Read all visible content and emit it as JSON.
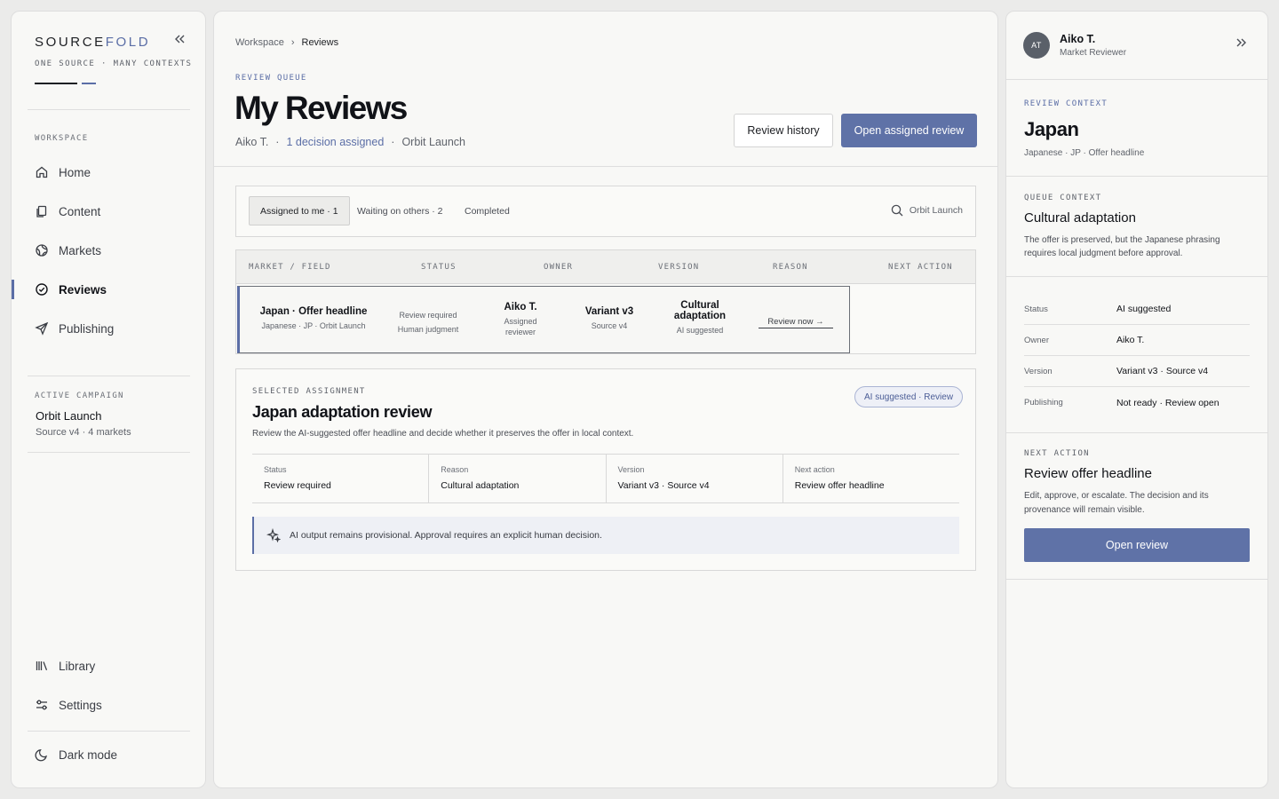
{
  "brand": {
    "name_part1": "SOURCE",
    "name_part2": "FOLD",
    "tagline": "ONE SOURCE · MANY CONTEXTS",
    "accent_color": "#5b6ea6"
  },
  "sidebar": {
    "section_label": "WORKSPACE",
    "items": [
      {
        "label": "Home",
        "icon": "home-icon"
      },
      {
        "label": "Content",
        "icon": "document-icon"
      },
      {
        "label": "Markets",
        "icon": "globe-icon"
      },
      {
        "label": "Reviews",
        "icon": "check-circle-icon",
        "active": true
      },
      {
        "label": "Publishing",
        "icon": "send-icon"
      }
    ],
    "campaign": {
      "label": "ACTIVE CAMPAIGN",
      "name": "Orbit Launch",
      "meta": "Source v4 · 4 markets"
    },
    "bottom_items": [
      {
        "label": "Library",
        "icon": "library-icon"
      },
      {
        "label": "Settings",
        "icon": "sliders-icon"
      }
    ],
    "dark_mode_label": "Dark mode"
  },
  "main": {
    "breadcrumb": [
      "Workspace",
      "Reviews"
    ],
    "eyebrow": "REVIEW QUEUE",
    "title": "My Reviews",
    "meta": {
      "user": "Aiko T.",
      "assigned": "1 decision assigned",
      "campaign": "Orbit Launch"
    },
    "buttons": {
      "history": "Review history",
      "open_assigned": "Open assigned review"
    },
    "tabs": [
      {
        "label": "Assigned to me · 1",
        "active": true
      },
      {
        "label": "Waiting on others · 2"
      },
      {
        "label": "Completed"
      }
    ],
    "search_label": "Orbit Launch",
    "table": {
      "headers": [
        "MARKET / FIELD",
        "STATUS",
        "OWNER",
        "VERSION",
        "REASON",
        "NEXT ACTION"
      ],
      "row": {
        "field": "Japan · Offer headline",
        "field_meta": "Japanese · JP · Orbit Launch",
        "status": "Review required",
        "status_meta": "Human judgment",
        "owner": "Aiko T.",
        "owner_meta_1": "Assigned",
        "owner_meta_2": "reviewer",
        "version": "Variant v3",
        "version_meta": "Source v4",
        "reason_1": "Cultural",
        "reason_2": "adaptation",
        "reason_meta": "AI suggested",
        "action": "Review now →"
      }
    },
    "assignment": {
      "eyebrow": "SELECTED ASSIGNMENT",
      "title": "Japan adaptation review",
      "description": "Review the AI-suggested offer headline and decide whether it preserves the offer in local context.",
      "badge": "AI suggested · Review",
      "fields": [
        {
          "key": "Status",
          "value": "Review required"
        },
        {
          "key": "Reason",
          "value": "Cultural adaptation"
        },
        {
          "key": "Version",
          "value": "Variant v3 · Source v4"
        },
        {
          "key": "Next action",
          "value": "Review offer headline"
        }
      ],
      "notice": "AI output remains provisional. Approval requires an explicit human decision."
    }
  },
  "rightpanel": {
    "user": {
      "initials": "AT",
      "name": "Aiko T.",
      "role": "Market Reviewer"
    },
    "review_context": {
      "label": "REVIEW CONTEXT",
      "title": "Japan",
      "meta": "Japanese · JP · Offer headline"
    },
    "queue_context": {
      "label": "QUEUE CONTEXT",
      "title": "Cultural adaptation",
      "description": "The offer is preserved, but the Japanese phrasing requires local judgment before approval."
    },
    "details": [
      {
        "key": "Status",
        "value": "AI suggested"
      },
      {
        "key": "Owner",
        "value": "Aiko T."
      },
      {
        "key": "Version",
        "value": "Variant v3 · Source v4"
      },
      {
        "key": "Publishing",
        "value": "Not ready · Review open"
      }
    ],
    "next_action": {
      "label": "NEXT ACTION",
      "title": "Review offer headline",
      "description": "Edit, approve, or escalate. The decision and its provenance will remain visible.",
      "button": "Open review"
    }
  }
}
